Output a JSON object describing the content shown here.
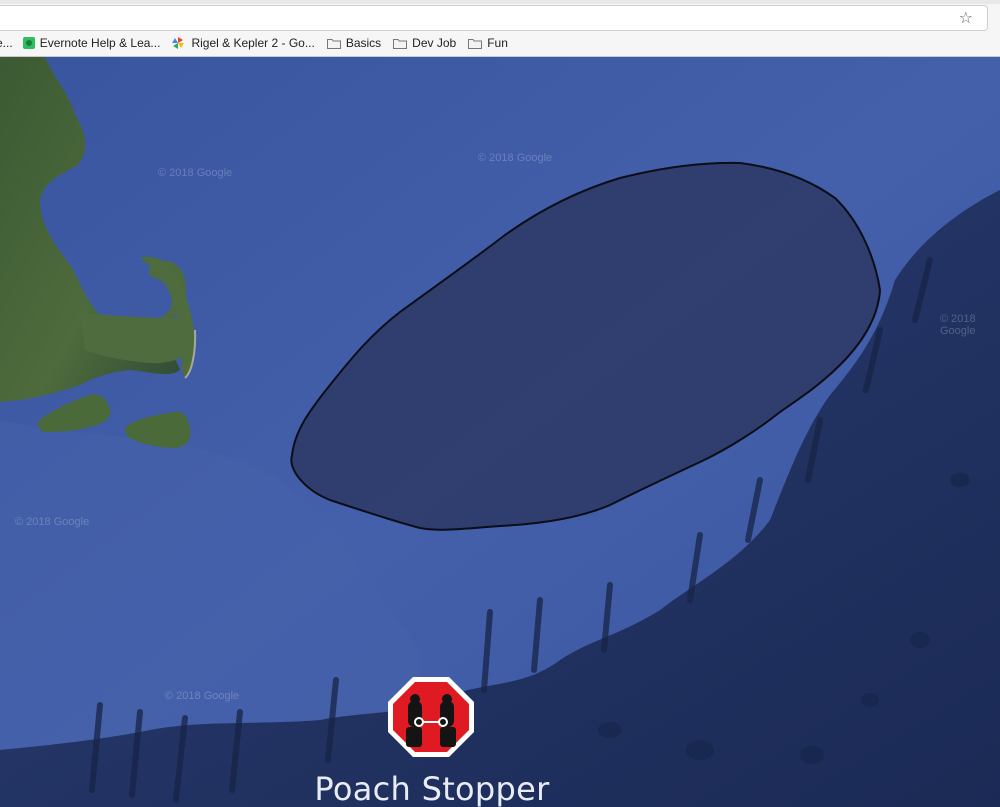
{
  "browser": {
    "bookmarks": [
      {
        "label": "e...",
        "icon": "page-icon"
      },
      {
        "label": "Evernote Help & Lea...",
        "icon": "evernote-icon"
      },
      {
        "label": "Rigel & Kepler 2 - Go...",
        "icon": "pinwheel-icon"
      },
      {
        "label": "Basics",
        "icon": "folder-icon"
      },
      {
        "label": "Dev Job",
        "icon": "folder-icon"
      },
      {
        "label": "Fun",
        "icon": "folder-icon"
      }
    ],
    "bookmark_star_icon": "star-icon"
  },
  "map": {
    "imagery": "satellite",
    "region": "Massachusetts coast / Gulf of Maine",
    "watermarks": [
      "© 2018 Google",
      "© 2018 Google",
      "© 2018 Google",
      "© 2018 Google",
      "© 2018 Google"
    ],
    "polygon_fill": "#2e3a66",
    "polygon_stroke": "#0b0d18",
    "ocean_color": "#3e5aa2",
    "shelf_color": "#20305e"
  },
  "brand": {
    "name": "Poach Stopper",
    "logo_icon": "handcuffed-hands-icon",
    "logo_color": "#e01a22"
  }
}
